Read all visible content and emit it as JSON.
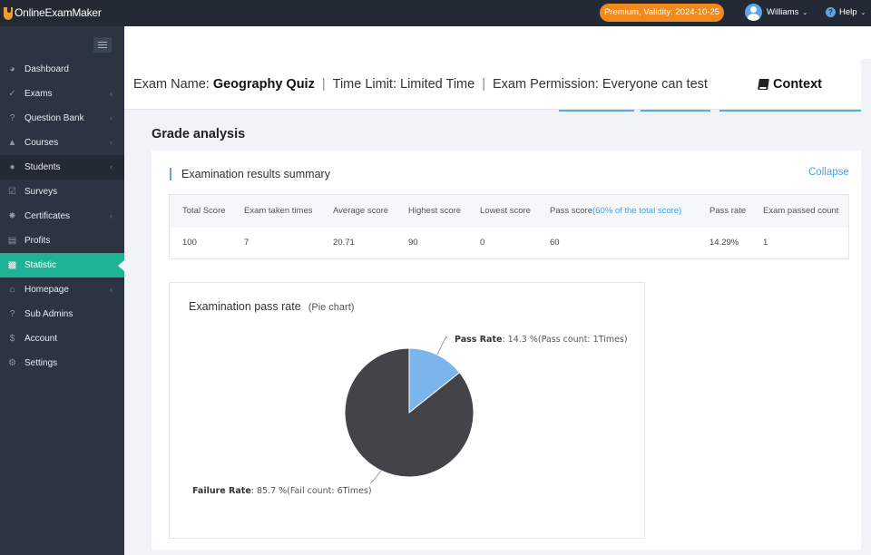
{
  "app": {
    "name": "OnlineExamMaker"
  },
  "topbar": {
    "premium": "Premium, Validity: 2024-10-25",
    "user": "Williams",
    "help": "Help"
  },
  "sidebar": {
    "items": [
      {
        "label": "Dashboard",
        "icon": "dashboard-icon",
        "chevron": false
      },
      {
        "label": "Exams",
        "icon": "check-circle-icon",
        "chevron": true
      },
      {
        "label": "Question Bank",
        "icon": "question-icon",
        "chevron": true
      },
      {
        "label": "Courses",
        "icon": "graduation-cap-icon",
        "chevron": true
      },
      {
        "label": "Students",
        "icon": "users-icon",
        "chevron": true
      },
      {
        "label": "Surveys",
        "icon": "checkbox-icon",
        "chevron": false
      },
      {
        "label": "Certificates",
        "icon": "certificate-icon",
        "chevron": true
      },
      {
        "label": "Profits",
        "icon": "card-icon",
        "chevron": false
      },
      {
        "label": "Statistic",
        "icon": "bar-chart-icon",
        "chevron": false
      },
      {
        "label": "Homepage",
        "icon": "home-icon",
        "chevron": true
      },
      {
        "label": "Sub Admins",
        "icon": "help-circle-icon",
        "chevron": false
      },
      {
        "label": "Account",
        "icon": "dollar-icon",
        "chevron": false
      },
      {
        "label": "Settings",
        "icon": "gear-icon",
        "chevron": false
      }
    ],
    "active": "Statistic"
  },
  "exam_info": {
    "name_label": "Exam Name: ",
    "name_value": "Geography Quiz",
    "sep": "|",
    "time_limit": "Time Limit: Limited Time",
    "permission": "Exam Permission: Everyone can test",
    "context": "Context"
  },
  "grade": {
    "title": "Grade analysis",
    "summary_title": "Examination results summary",
    "collapse": "Collapse",
    "headers": {
      "total": "Total Score",
      "taken": "Exam taken times",
      "average": "Average score",
      "highest": "Highest score",
      "lowest": "Lowest score",
      "pass": "Pass score",
      "pass_note": "(60% of the total score)",
      "rate": "Pass rate",
      "passed": "Exam passed count"
    },
    "values": {
      "total": "100",
      "taken": "7",
      "average": "20.71",
      "highest": "90",
      "lowest": "0",
      "pass": "60",
      "rate": "14.29%",
      "passed": "1"
    }
  },
  "pie": {
    "title": "Examination pass rate",
    "subtitle": "(Pie chart)",
    "pass_label": "Pass Rate",
    "pass_text": ": 14.3 %(Pass count: 1Times)",
    "fail_label": "Failure Rate",
    "fail_text": ": 85.7 %(Fail count: 6Times)"
  },
  "chart_data": {
    "type": "pie",
    "title": "Examination pass rate",
    "subtitle": "(Pie chart)",
    "slices": [
      {
        "label": "Pass Rate",
        "value": 14.3,
        "count": 1,
        "color": "#7cb5ec"
      },
      {
        "label": "Failure Rate",
        "value": 85.7,
        "count": 6,
        "color": "#434348"
      }
    ]
  },
  "colors": {
    "accent": "#1fb395",
    "premium": "#f08a1c",
    "link": "#4aa3dc"
  }
}
